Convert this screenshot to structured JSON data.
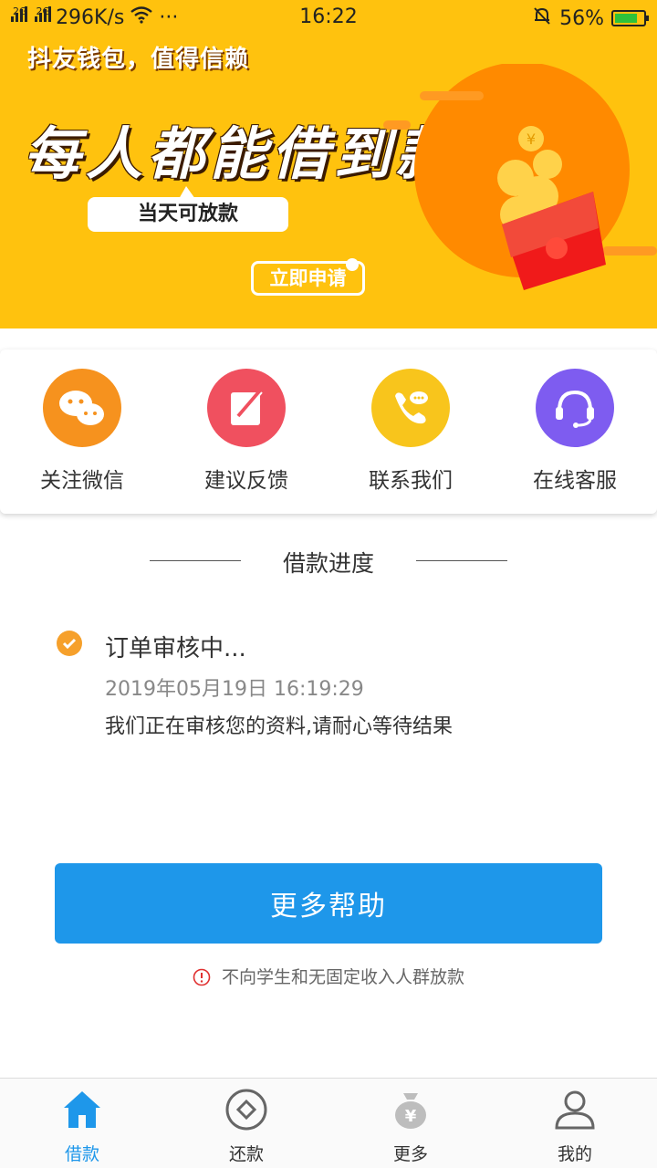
{
  "status_bar": {
    "net1": "2G",
    "net2": "2G",
    "speed": "296K/s",
    "dots": "···",
    "time": "16:22",
    "battery": "56%"
  },
  "banner": {
    "tagline": "抖友钱包，值得信赖",
    "headline": "每人都能借到款",
    "bubble": "当天可放款",
    "apply_label": "立即申请",
    "coin_symbol": "¥"
  },
  "actions": [
    {
      "label": "关注微信",
      "icon": "wechat-icon",
      "color": "#F6921E"
    },
    {
      "label": "建议反馈",
      "icon": "feedback-icon",
      "color": "#F0505F"
    },
    {
      "label": "联系我们",
      "icon": "phone-icon",
      "color": "#F8C51C"
    },
    {
      "label": "在线客服",
      "icon": "headset-icon",
      "color": "#7E5CF0"
    }
  ],
  "progress": {
    "title": "借款进度",
    "step_title": "订单审核中...",
    "step_time": "2019年05月19日 16:19:29",
    "step_desc": "我们正在审核您的资料,请耐心等待结果"
  },
  "help_button": "更多帮助",
  "notice": "不向学生和无固定收入人群放款",
  "tabs": [
    {
      "label": "借款",
      "icon": "home-icon",
      "active": true
    },
    {
      "label": "还款",
      "icon": "repay-icon",
      "active": false
    },
    {
      "label": "更多",
      "icon": "money-bag-icon",
      "active": false
    },
    {
      "label": "我的",
      "icon": "profile-icon",
      "active": false
    }
  ],
  "colors": {
    "banner": "#FFC20E",
    "accent": "#1E97EA",
    "check": "#F6A02B"
  }
}
